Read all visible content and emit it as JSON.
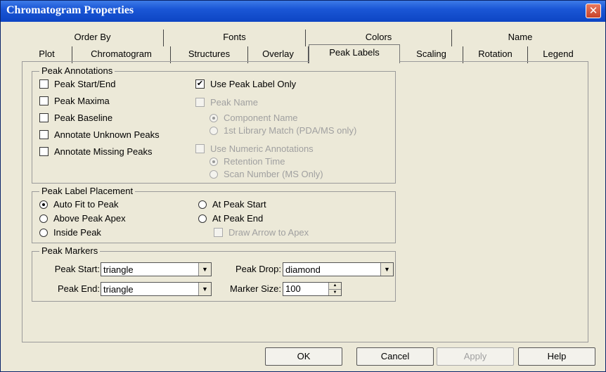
{
  "window": {
    "title": "Chromatogram Properties",
    "close_symbol": "✕"
  },
  "tabs_row1": [
    "Order By",
    "Fonts",
    "Colors",
    "Name"
  ],
  "tabs_row2": [
    "Plot",
    "Chromatogram",
    "Structures",
    "Overlay",
    "Peak Labels",
    "Scaling",
    "Rotation",
    "Legend"
  ],
  "active_tab": "Peak Labels",
  "peak_annotations": {
    "title": "Peak Annotations",
    "left": [
      {
        "label": "Peak Start/End",
        "checked": false
      },
      {
        "label": "Peak Maxima",
        "checked": false
      },
      {
        "label": "Peak Baseline",
        "checked": false
      },
      {
        "label": "Annotate Unknown Peaks",
        "checked": false
      },
      {
        "label": "Annotate Missing Peaks",
        "checked": false
      }
    ],
    "use_peak_label_only": {
      "label": "Use Peak Label Only",
      "checked": true
    },
    "peak_name": {
      "label": "Peak Name",
      "checked": false,
      "disabled": true
    },
    "component_name": {
      "label": "Component Name",
      "selected": true,
      "disabled": true
    },
    "library_match": {
      "label": "1st Library Match (PDA/MS only)",
      "selected": false,
      "disabled": true
    },
    "use_numeric": {
      "label": "Use Numeric Annotations",
      "checked": false,
      "disabled": true
    },
    "retention_time": {
      "label": "Retention Time",
      "selected": true,
      "disabled": true
    },
    "scan_number": {
      "label": "Scan Number (MS Only)",
      "selected": false,
      "disabled": true
    }
  },
  "placement": {
    "title": "Peak Label Placement",
    "auto_fit": {
      "label": "Auto Fit to Peak",
      "selected": true
    },
    "above_apex": {
      "label": "Above Peak Apex",
      "selected": false
    },
    "inside_peak": {
      "label": "Inside Peak",
      "selected": false
    },
    "at_start": {
      "label": "At Peak Start",
      "selected": false
    },
    "at_end": {
      "label": "At Peak End",
      "selected": false
    },
    "draw_arrow": {
      "label": "Draw Arrow to Apex",
      "checked": false,
      "disabled": true
    }
  },
  "markers": {
    "title": "Peak Markers",
    "peak_start_label": "Peak Start:",
    "peak_start_value": "triangle",
    "peak_end_label": "Peak End:",
    "peak_end_value": "triangle",
    "peak_drop_label": "Peak Drop:",
    "peak_drop_value": "diamond",
    "marker_size_label": "Marker Size:",
    "marker_size_value": "100"
  },
  "buttons": {
    "ok": "OK",
    "cancel": "Cancel",
    "apply": "Apply",
    "help": "Help"
  }
}
